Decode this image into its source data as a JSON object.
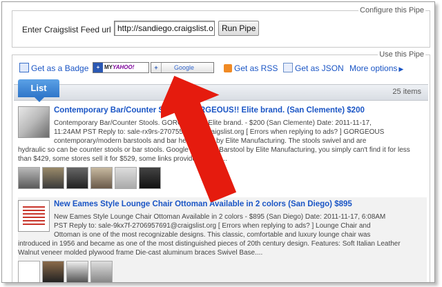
{
  "config": {
    "legend": "Configure this Pipe",
    "feed_label": "Enter Craigslist Feed url",
    "feed_value": "http://sandiego.craigslist.o",
    "run_label": "Run Pipe"
  },
  "use": {
    "legend": "Use this Pipe",
    "toolbar": {
      "badge": "Get as a Badge",
      "yahoo_my": "MY",
      "yahoo_brand": "YAHOO!",
      "google": "Google",
      "rss": "Get as RSS",
      "json": "Get as JSON",
      "more": "More options"
    },
    "list_tab": "List",
    "count": "25 items"
  },
  "items": [
    {
      "title": "Contemporary Bar/Counter Stools. GORGEOUS!! Elite brand. (San Clemente) $200",
      "desc_line1": "Contemporary Bar/Counter Stools. GORGEOUS!! Elite brand. - $200 (San Clemente) Date: 2011-11-17,",
      "desc_line2": "11:24AM PST Reply to: sale-rx9rs-2707556261@craigslist.org [ Errors when replying to ads? ] GORGEOUS",
      "desc_line3": "contemporary/modern barstools and bar height table by Elite Manufacturing. The stools swivel and are",
      "desc_rest": "hydraulic so can be counter stools or bar stools. Google the Lana Barstool by Elite Manufacturing, you simply can't find it for less than $429, some stores sell it for $529, some links provided below...."
    },
    {
      "title": "New Eames Style Lounge Chair Ottoman Available in 2 colors (San Diego) $895",
      "desc_line1": "New Eames Style Lounge Chair Ottoman Available in 2 colors - $895 (San Diego) Date: 2011-11-17, 6:08AM",
      "desc_line2": "PST Reply to: sale-9kx7f-2706957691@craigslist.org [ Errors when replying to ads? ] Lounge Chair and",
      "desc_line3": "Ottoman is one of the most recognizable designs. This classic, comfortable and luxury lounge chair was",
      "desc_rest": "introduced in 1956 and became as one of the most distinguished pieces of 20th century design. Features: Soft Italian Leather Walnut veneer molded plywood frame Die-cast aluminum braces Swivel Base...."
    }
  ],
  "colors": {
    "link": "#1a55c5",
    "tab": "#2f76c9",
    "arrow": "#e51b0e"
  }
}
